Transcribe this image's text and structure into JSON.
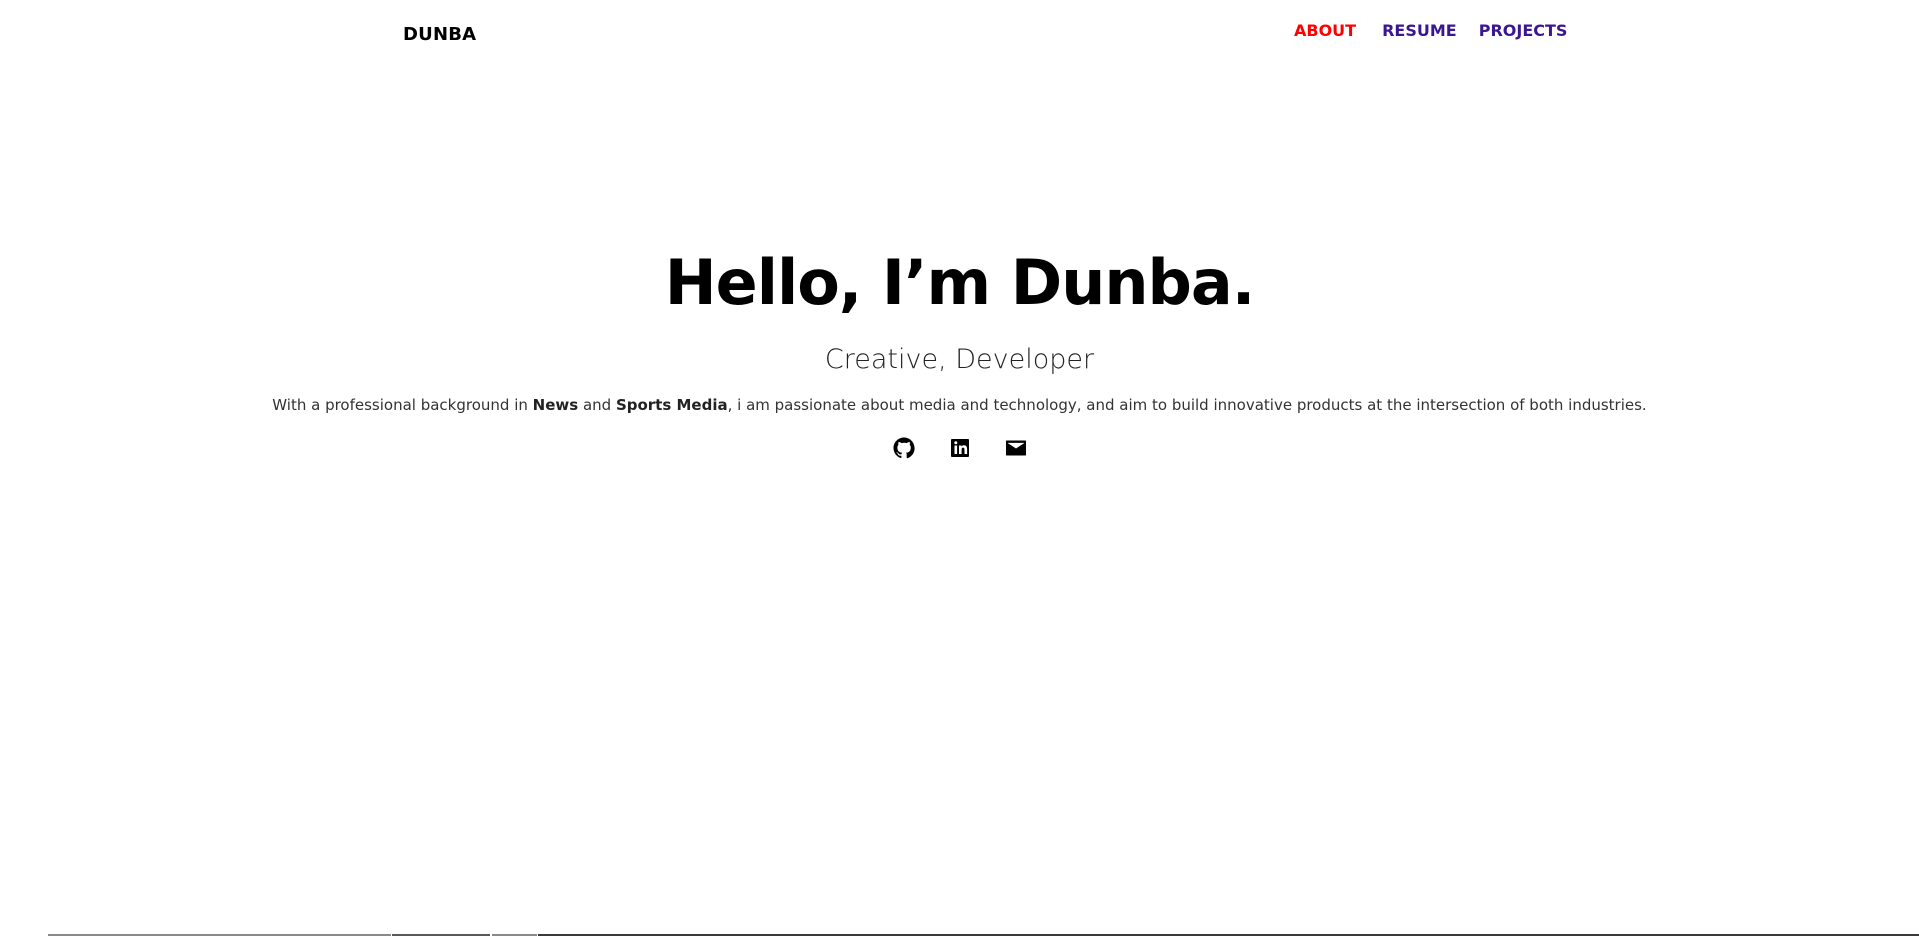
{
  "header": {
    "logo": "DUNBA",
    "nav": [
      {
        "label": "ABOUT"
      },
      {
        "label": "RESUME"
      },
      {
        "label": "PROJECTS"
      }
    ]
  },
  "hero": {
    "title": "Hello, I’m Dunba.",
    "subtitle": "Creative, Developer",
    "bio_part1": "With a professional background in ",
    "bio_bold1": "News",
    "bio_part2": " and ",
    "bio_bold2": "Sports Media",
    "bio_part3": ", i am passionate about media and technology, and aim to build innovative products at the intersection of both industries."
  },
  "socials": [
    {
      "icon": "github-icon"
    },
    {
      "icon": "linkedin-icon"
    },
    {
      "icon": "mail-icon"
    }
  ],
  "colors": {
    "nav_active": "#ff0000",
    "nav_visited": "#3b1691",
    "text": "#000000"
  }
}
